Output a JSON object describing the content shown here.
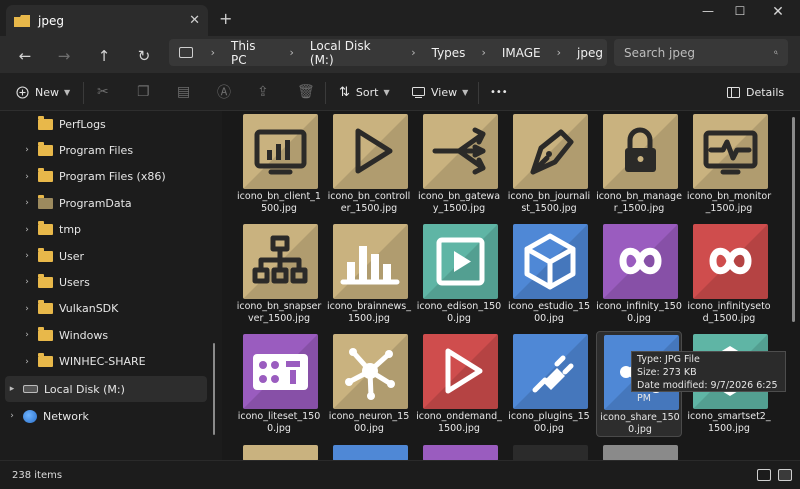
{
  "window": {
    "tab_title": "jpeg",
    "tab_close": "✕",
    "new_tab": "+",
    "minimize": "—",
    "maximize": "☐",
    "close": "✕"
  },
  "address": {
    "crumbs": [
      "This PC",
      "Local Disk (M:)",
      "Types",
      "IMAGE",
      "jpeg"
    ],
    "search_placeholder": "Search jpeg"
  },
  "toolbar": {
    "new_label": "New",
    "sort_label": "Sort",
    "view_label": "View",
    "more_label": "•••",
    "details_label": "Details"
  },
  "sidebar": {
    "items": [
      {
        "label": "PerfLogs",
        "expandable": false
      },
      {
        "label": "Program Files",
        "expandable": true
      },
      {
        "label": "Program Files (x86)",
        "expandable": true
      },
      {
        "label": "ProgramData",
        "expandable": true
      },
      {
        "label": "tmp",
        "expandable": true
      },
      {
        "label": "User",
        "expandable": true
      },
      {
        "label": "Users",
        "expandable": true
      },
      {
        "label": "VulkanSDK",
        "expandable": true
      },
      {
        "label": "Windows",
        "expandable": true
      },
      {
        "label": "WINHEC-SHARE",
        "expandable": true
      }
    ],
    "drive_label": "Local Disk (M:)",
    "network_label": "Network"
  },
  "files": [
    {
      "name": "icono_bn_client_1500.jpg",
      "icon": "dashboard-monitor-icon",
      "bg": "#c9b27f",
      "fg": "#2b2a28"
    },
    {
      "name": "icono_bn_controller_1500.jpg",
      "icon": "play-icon",
      "bg": "#c9b27f",
      "fg": "#2b2a28"
    },
    {
      "name": "icono_bn_gateway_1500.jpg",
      "icon": "gateway-arrows-icon",
      "bg": "#c9b27f",
      "fg": "#2b2a28"
    },
    {
      "name": "icono_bn_journalist_1500.jpg",
      "icon": "pen-nib-icon",
      "bg": "#c9b27f",
      "fg": "#2b2a28"
    },
    {
      "name": "icono_bn_manager_1500.jpg",
      "icon": "lock-icon",
      "bg": "#c9b27f",
      "fg": "#2b2a28"
    },
    {
      "name": "icono_bn_monitor_1500.jpg",
      "icon": "pulse-monitor-icon",
      "bg": "#c9b27f",
      "fg": "#2b2a28"
    },
    {
      "name": "icono_bn_snapserver_1500.jpg",
      "icon": "hierarchy-icon",
      "bg": "#c9b27f",
      "fg": "#2b2a28"
    },
    {
      "name": "icono_brainnews_1500.jpg",
      "icon": "bar-chart-icon",
      "bg": "#c9b27f",
      "fg": "#ffffff"
    },
    {
      "name": "icono_edison_1500.jpg",
      "icon": "video-play-icon",
      "bg": "#5fb5a5",
      "fg": "#ffffff"
    },
    {
      "name": "icono_estudio_1500.jpg",
      "icon": "cube-icon",
      "bg": "#4f88d6",
      "fg": "#ffffff"
    },
    {
      "name": "icono_infinity_1500.jpg",
      "icon": "infinity-icon",
      "bg": "#9a5cbf",
      "fg": "#ffffff"
    },
    {
      "name": "icono_infinitysetod_1500.jpg",
      "icon": "infinity-icon",
      "bg": "#cf4d4d",
      "fg": "#ffffff"
    },
    {
      "name": "icono_liteset_1500.jpg",
      "icon": "control-panel-icon",
      "bg": "#9a5cbf",
      "fg": "#ffffff"
    },
    {
      "name": "icono_neuron_1500.jpg",
      "icon": "neuron-icon",
      "bg": "#c9b27f",
      "fg": "#ffffff"
    },
    {
      "name": "icono_ondemand_1500.jpg",
      "icon": "play-icon",
      "bg": "#cf4d4d",
      "fg": "#ffffff"
    },
    {
      "name": "icono_plugins_1500.jpg",
      "icon": "plug-icon",
      "bg": "#4f88d6",
      "fg": "#ffffff"
    },
    {
      "name": "icono_share_1500.jpg",
      "icon": "share-icon",
      "bg": "#4f88d6",
      "fg": "#ffffff"
    },
    {
      "name": "icono_smartset2_1500.jpg",
      "icon": "smartset-icon",
      "bg": "#5fb5a5",
      "fg": "#ffffff"
    }
  ],
  "partial_row_colors": [
    "#c9b27f",
    "#4f88d6",
    "#9a5cbf",
    "#2b2b2b",
    "#8a8a8a"
  ],
  "tooltip": {
    "type": "Type: JPG File",
    "size": "Size: 273 KB",
    "modified": "Date modified: 9/7/2026 6:25 PM"
  },
  "status": {
    "count": "238 items"
  }
}
